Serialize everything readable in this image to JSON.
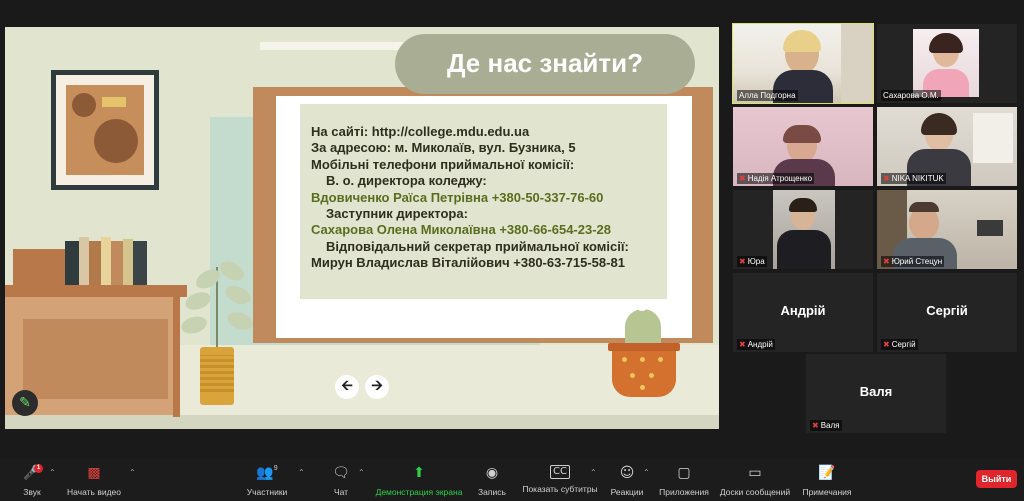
{
  "slide": {
    "title": "Де нас знайти?",
    "lines": [
      "На сайті: http://college.mdu.edu.ua",
      "За адресою: м. Миколаїв, вул. Бузника, 5",
      "Мобільні телефони приймальної комісії:",
      "В. о. директора коледжу:",
      "Вдовиченко Раїса Петрівна +380-50-337-76-60",
      "Заступник директора:",
      "Сахарова Олена Миколаївна +380-66-654-23-28",
      "Відповідальний секретар приймальної комісії:",
      "Мирун Владислав Віталійович +380-63-715-58-81"
    ],
    "prev_icon": "arrow-left-icon",
    "next_icon": "arrow-right-icon",
    "pen_icon": "pen-icon"
  },
  "participants": [
    {
      "name": "Алла Подгорна",
      "video": true,
      "muted": false,
      "active": true
    },
    {
      "name": "Сахарова О.М.",
      "video": true,
      "muted": false,
      "active": false
    },
    {
      "name": "Надія Атрощенко",
      "video": true,
      "muted": true,
      "active": false
    },
    {
      "name": "NIKA NIKITUK",
      "video": true,
      "muted": true,
      "active": false
    },
    {
      "name": "Юра",
      "video": true,
      "muted": true,
      "active": false
    },
    {
      "name": "Юрий Стецун",
      "video": true,
      "muted": true,
      "active": false
    },
    {
      "name": "Андрій",
      "video": false,
      "muted": true,
      "active": false
    },
    {
      "name": "Сергій",
      "video": false,
      "muted": true,
      "active": false
    },
    {
      "name": "Валя",
      "video": false,
      "muted": true,
      "active": false
    }
  ],
  "toolbar": {
    "sound": "Звук",
    "start_video": "Начать видео",
    "participants": "Участники",
    "participants_count": "9",
    "chat": "Чат",
    "share": "Демонстрация экрана",
    "record": "Запись",
    "subtitles": "Показать субтитры",
    "reactions": "Реакции",
    "apps": "Приложения",
    "whiteboard": "Доски сообщений",
    "notes": "Примечания",
    "leave": "Выйти",
    "sound_badge": "1"
  },
  "colors": {
    "accent_green": "#2ed04a",
    "leave_red": "#e0252c",
    "active_speaker": "#d8e26a"
  }
}
